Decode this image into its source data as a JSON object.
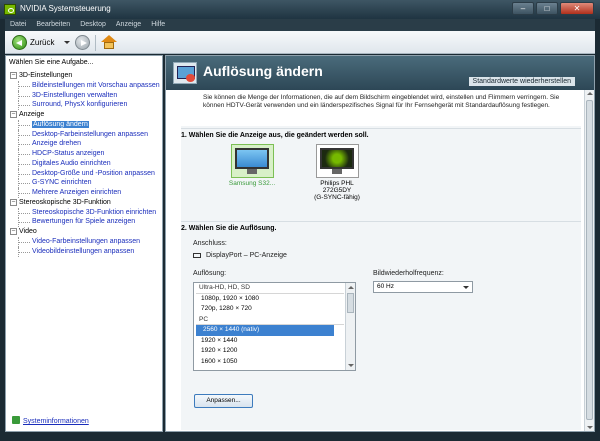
{
  "window": {
    "title": "NVIDIA Systemsteuerung"
  },
  "menu": [
    "Datei",
    "Bearbeiten",
    "Desktop",
    "Anzeige",
    "Hilfe"
  ],
  "toolbar": {
    "back_label": "Zurück"
  },
  "left": {
    "header": "Wählen Sie eine Aufgabe...",
    "tree": [
      {
        "type": "cat",
        "label": "3D-Einstellungen"
      },
      {
        "type": "item",
        "label": "Bildeinstellungen mit Vorschau anpassen"
      },
      {
        "type": "item",
        "label": "3D-Einstellungen verwalten"
      },
      {
        "type": "item",
        "label": "Surround, PhysX konfigurieren"
      },
      {
        "type": "cat",
        "label": "Anzeige"
      },
      {
        "type": "item",
        "label": "Auflösung ändern",
        "selected": true
      },
      {
        "type": "item",
        "label": "Desktop-Farbeinstellungen anpassen"
      },
      {
        "type": "item",
        "label": "Anzeige drehen"
      },
      {
        "type": "item",
        "label": "HDCP-Status anzeigen"
      },
      {
        "type": "item",
        "label": "Digitales Audio einrichten"
      },
      {
        "type": "item",
        "label": "Desktop-Größe und -Position anpassen"
      },
      {
        "type": "item",
        "label": "G-SYNC einrichten"
      },
      {
        "type": "item",
        "label": "Mehrere Anzeigen einrichten"
      },
      {
        "type": "cat",
        "label": "Stereoskopische 3D-Funktion"
      },
      {
        "type": "item",
        "label": "Stereoskopische 3D-Funktion einrichten"
      },
      {
        "type": "item",
        "label": "Bewertungen für Spiele anzeigen"
      },
      {
        "type": "cat",
        "label": "Video"
      },
      {
        "type": "item",
        "label": "Video-Farbeinstellungen anpassen"
      },
      {
        "type": "item",
        "label": "Videobildeinstellungen anpassen"
      }
    ],
    "sysinfo": "Systeminformationen"
  },
  "main": {
    "title": "Auflösung ändern",
    "defaults_link": "Standardwerte wiederherstellen",
    "description": "Sie können die Menge der Informationen, die auf dem Bildschirm eingeblendet wird, einstellen und Flimmern verringern. Sie können HDTV-Gerät verwenden und ein länderspezifisches Signal für Ihr Fernsehgerät mit Standardauflösung festlegen.",
    "section1": "1. Wählen Sie die Anzeige aus, die geändert werden soll.",
    "monitor1": "Samsung S32...",
    "monitor2_line1": "Philips PHL 272G5DY",
    "monitor2_line2": "(G-SYNC-fähig)",
    "section2": "2. Wählen Sie die Auflösung.",
    "connection_label": "Anschluss:",
    "connection_value": "DisplayPort – PC-Anzeige",
    "resolution_label": "Auflösung:",
    "refresh_label": "Bildwiederholfrequenz:",
    "refresh_value": "60 Hz",
    "resolutions": [
      {
        "type": "group",
        "label": "Ultra-HD, HD, SD"
      },
      {
        "type": "row",
        "label": "1080p, 1920 × 1080"
      },
      {
        "type": "row",
        "label": "720p, 1280 × 720"
      },
      {
        "type": "group",
        "label": "PC"
      },
      {
        "type": "row",
        "label": "2560 × 1440 (nativ)",
        "selected": true
      },
      {
        "type": "row",
        "label": "1920 × 1440"
      },
      {
        "type": "row",
        "label": "1920 × 1200"
      },
      {
        "type": "row",
        "label": "1600 × 1050"
      }
    ],
    "customize_button": "Anpassen..."
  }
}
